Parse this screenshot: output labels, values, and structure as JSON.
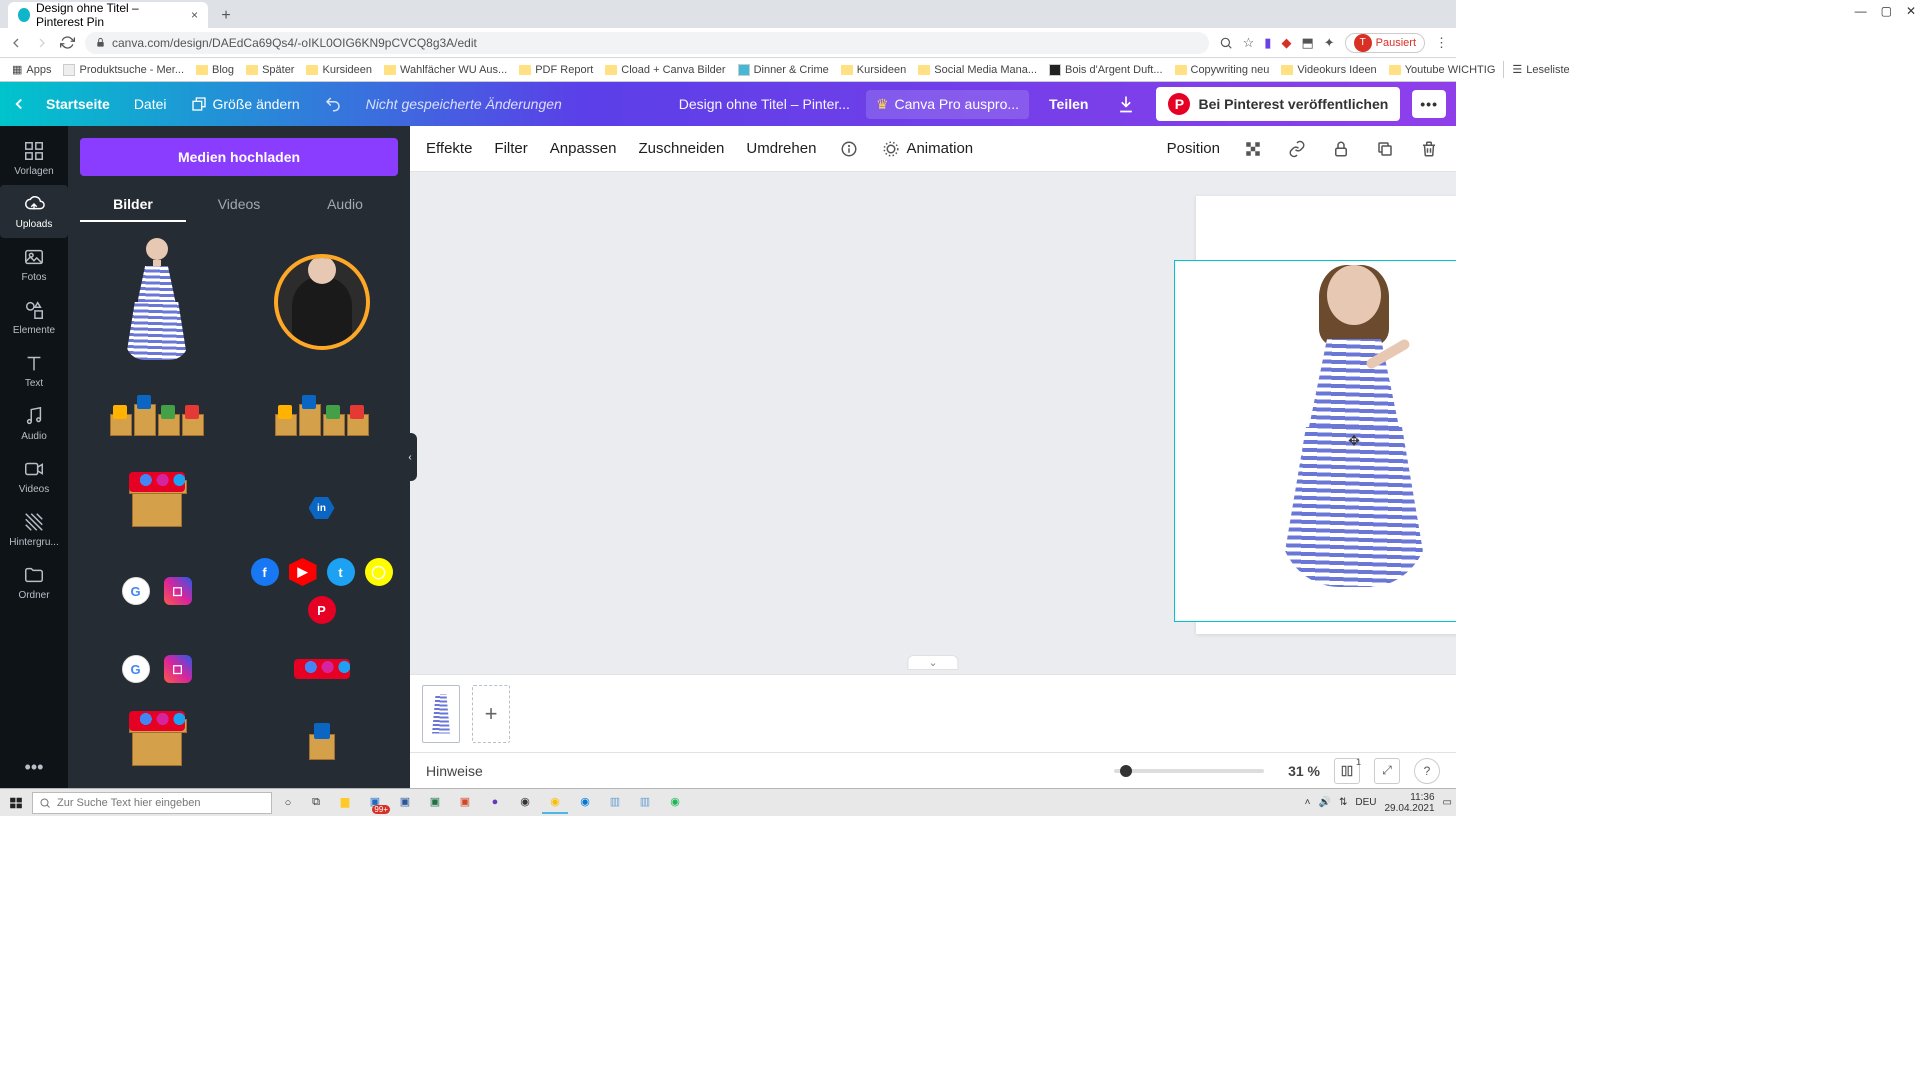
{
  "browser": {
    "tab_title": "Design ohne Titel – Pinterest Pin",
    "tab_close": "×",
    "new_tab": "+",
    "url": "canva.com/design/DAEdCa69Qs4/-oIKL0OIG6KN9pCVCQ8g3A/edit",
    "pause_label": "Pausiert",
    "avatar_letter": "T",
    "win": {
      "min": "—",
      "max": "▢",
      "close": "✕"
    },
    "bookmarks": [
      "Apps",
      "Produktsuche - Mer...",
      "Blog",
      "Später",
      "Kursideen",
      "Wahlfächer WU Aus...",
      "PDF Report",
      "Cload + Canva Bilder",
      "Dinner & Crime",
      "Kursideen",
      "Social Media Mana...",
      "Bois d'Argent Duft...",
      "Copywriting neu",
      "Videokurs Ideen",
      "Youtube WICHTIG"
    ],
    "reading_list": "Leseliste"
  },
  "header": {
    "home": "Startseite",
    "file": "Datei",
    "resize": "Größe ändern",
    "save_state": "Nicht gespeicherte Änderungen",
    "title": "Design ohne Titel – Pinter...",
    "pro": "Canva Pro auspro...",
    "share": "Teilen",
    "pinterest": "Bei Pinterest veröffentlichen",
    "pinterest_letter": "P",
    "more": "•••"
  },
  "rail": {
    "vorlagen": "Vorlagen",
    "uploads": "Uploads",
    "fotos": "Fotos",
    "elemente": "Elemente",
    "text": "Text",
    "audio": "Audio",
    "videos": "Videos",
    "hintergrund": "Hintergru...",
    "ordner": "Ordner",
    "more": "•••"
  },
  "panel": {
    "upload_btn": "Medien hochladen",
    "tabs": {
      "bilder": "Bilder",
      "videos": "Videos",
      "audio": "Audio"
    },
    "collapse": "‹"
  },
  "toolbar": {
    "effekte": "Effekte",
    "filter": "Filter",
    "anpassen": "Anpassen",
    "zuschneiden": "Zuschneiden",
    "umdrehen": "Umdrehen",
    "animation": "Animation",
    "position": "Position"
  },
  "canvas": {
    "move_cursor": "✥",
    "page_ctrl": "⌄"
  },
  "pagestrip": {
    "add": "+"
  },
  "footer": {
    "hinweise": "Hinweise",
    "zoom": "31 %",
    "grid_badge": "1",
    "expand": "⤢",
    "help": "?"
  },
  "taskbar": {
    "search_placeholder": "Zur Suche Text hier eingeben",
    "tray_badge": "99+",
    "lang": "DEU",
    "time": "11:36",
    "date": "29.04.2021"
  }
}
